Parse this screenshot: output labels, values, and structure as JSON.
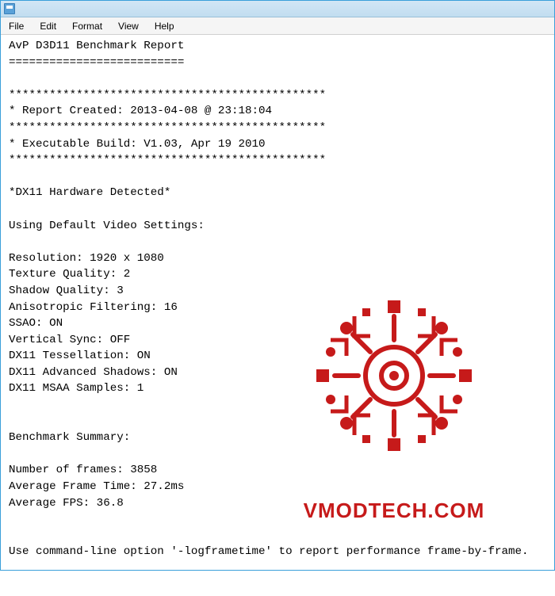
{
  "menubar": {
    "items": [
      {
        "label": "File"
      },
      {
        "label": "Edit"
      },
      {
        "label": "Format"
      },
      {
        "label": "View"
      },
      {
        "label": "Help"
      }
    ]
  },
  "report": {
    "title": "AvP D3D11 Benchmark Report",
    "title_underline": "==========================",
    "sep": "***********************************************",
    "created_line": "* Report Created: 2013-04-08 @ 23:18:04",
    "build_line": "* Executable Build: V1.03, Apr 19 2010",
    "hw_detected": "*DX11 Hardware Detected*",
    "settings_header": "Using Default Video Settings:",
    "settings": {
      "resolution": "Resolution: 1920 x 1080",
      "texture_quality": "Texture Quality: 2",
      "shadow_quality": "Shadow Quality: 3",
      "anisotropic": "Anisotropic Filtering: 16",
      "ssao": "SSAO: ON",
      "vsync": "Vertical Sync: OFF",
      "tessellation": "DX11 Tessellation: ON",
      "adv_shadows": "DX11 Advanced Shadows: ON",
      "msaa": "DX11 MSAA Samples: 1"
    },
    "summary_header": "Benchmark Summary:",
    "summary": {
      "num_frames": "Number of frames: 3858",
      "avg_frame_time": "Average Frame Time: 27.2ms",
      "avg_fps": "Average FPS: 36.8"
    },
    "footer_hint": "Use command-line option '-logframetime' to report performance frame-by-frame."
  },
  "watermark": {
    "text": "VMODTECH.COM",
    "color": "#c61a1a"
  }
}
